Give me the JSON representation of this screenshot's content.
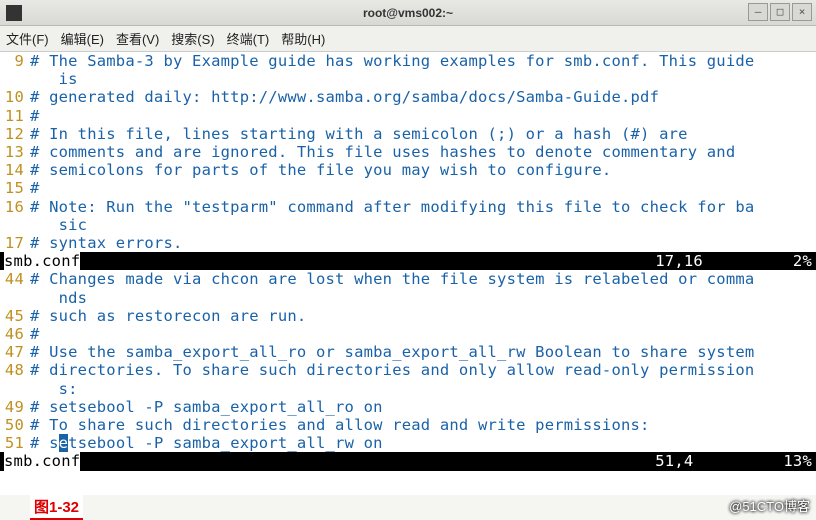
{
  "window": {
    "title": "root@vms002:~"
  },
  "menubar": {
    "file": "文件(F)",
    "edit": "编辑(E)",
    "view": "查看(V)",
    "search": "搜索(S)",
    "terminal": "终端(T)",
    "help": "帮助(H)"
  },
  "pane1": {
    "lines": {
      "l9n": "9",
      "l9t": "# The Samba-3 by Example guide has working examples for smb.conf. This guide",
      "l9c": "   is",
      "l10n": "10",
      "l10t": "# generated daily: http://www.samba.org/samba/docs/Samba-Guide.pdf",
      "l11n": "11",
      "l11t": "#",
      "l12n": "12",
      "l12t": "# In this file, lines starting with a semicolon (;) or a hash (#) are",
      "l13n": "13",
      "l13t": "# comments and are ignored. This file uses hashes to denote commentary and",
      "l14n": "14",
      "l14t": "# semicolons for parts of the file you may wish to configure.",
      "l15n": "15",
      "l15t": "#",
      "l16n": "16",
      "l16t": "# Note: Run the \"testparm\" command after modifying this file to check for ba",
      "l16c": "   sic",
      "l17n": "17",
      "l17t": "# syntax errors."
    },
    "status": {
      "name": "smb.conf",
      "pos": "17,16",
      "pct": "2%"
    }
  },
  "pane2": {
    "lines": {
      "l44n": "44",
      "l44t": "# Changes made via chcon are lost when the file system is relabeled or comma",
      "l44c": "   nds",
      "l45n": "45",
      "l45t": "# such as restorecon are run.",
      "l46n": "46",
      "l46t": "#",
      "l47n": "47",
      "l47t": "# Use the samba_export_all_ro or samba_export_all_rw Boolean to share system",
      "l48n": "48",
      "l48t": "# directories. To share such directories and only allow read-only permission",
      "l48c": "   s:",
      "l49n": "49",
      "l49t": "# setsebool -P samba_export_all_ro on",
      "l50n": "50",
      "l50t": "# To share such directories and allow read and write permissions:",
      "l51n": "51",
      "l51pre": "# s",
      "l51cur": "e",
      "l51post": "tsebool -P samba_export_all_rw on"
    },
    "status": {
      "name": "smb.conf",
      "pos": "51,4",
      "pct": "13%"
    }
  },
  "figure_label": "图1-32",
  "watermark": "@51CTO博客"
}
